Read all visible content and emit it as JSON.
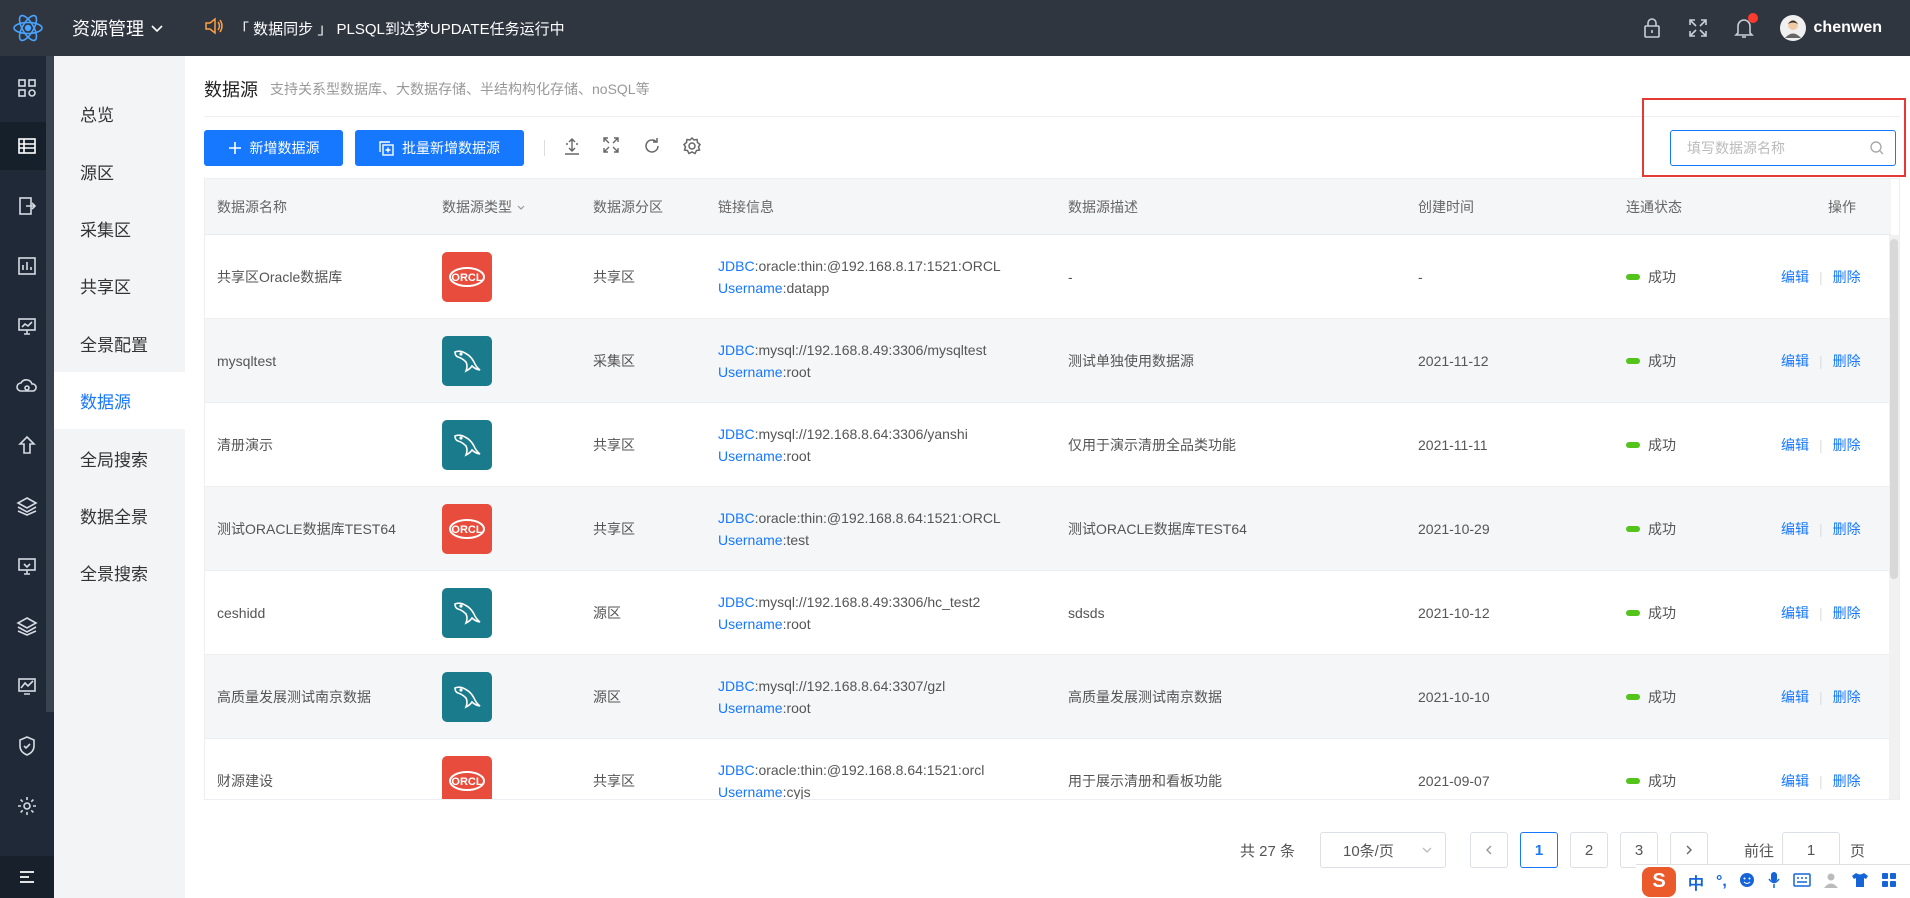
{
  "header": {
    "app_title": "资源管理",
    "announcement": "「 数据同步 」 PLSQL到达梦UPDATE任务运行中",
    "username": "chenwen"
  },
  "sidebar": {
    "items": [
      {
        "label": "总览"
      },
      {
        "label": "源区"
      },
      {
        "label": "采集区"
      },
      {
        "label": "共享区"
      },
      {
        "label": "全景配置"
      },
      {
        "label": "数据源",
        "active": true
      },
      {
        "label": "全局搜索"
      },
      {
        "label": "数据全景"
      },
      {
        "label": "全景搜索"
      }
    ]
  },
  "page": {
    "title": "数据源",
    "subtitle": "支持关系型数据库、大数据存储、半结构构化存储、noSQL等"
  },
  "toolbar": {
    "add_label": "新增数据源",
    "batch_add_label": "批量新增数据源"
  },
  "search": {
    "placeholder": "填写数据源名称",
    "value": ""
  },
  "table": {
    "columns": {
      "name": "数据源名称",
      "type": "数据源类型",
      "zone": "数据源分区",
      "link": "链接信息",
      "desc": "数据源描述",
      "created": "创建时间",
      "status": "连通状态",
      "ops": "操作"
    },
    "jdbc_label": "JDBC",
    "username_label": "Username",
    "edit_label": "编辑",
    "delete_label": "删除",
    "op_sep": "|",
    "rows": [
      {
        "name": "共享区Oracle数据库",
        "type": "oracle",
        "icon_text": "ORCL",
        "zone": "共享区",
        "jdbc": ":oracle:thin:@192.168.8.17:1521:ORCL",
        "username": ":datapp",
        "desc": "-",
        "created": "-",
        "status": "成功"
      },
      {
        "name": "mysqltest",
        "type": "mysql",
        "icon_text": "",
        "zone": "采集区",
        "jdbc": ":mysql://192.168.8.49:3306/mysqltest",
        "username": ":root",
        "desc": "测试单独使用数据源",
        "created": "2021-11-12",
        "status": "成功"
      },
      {
        "name": "清册演示",
        "type": "mysql",
        "icon_text": "",
        "zone": "共享区",
        "jdbc": ":mysql://192.168.8.64:3306/yanshi",
        "username": ":root",
        "desc": "仅用于演示清册全品类功能",
        "created": "2021-11-11",
        "status": "成功"
      },
      {
        "name": "测试ORACLE数据库TEST64",
        "type": "oracle",
        "icon_text": "ORCL",
        "zone": "共享区",
        "jdbc": ":oracle:thin:@192.168.8.64:1521:ORCL",
        "username": ":test",
        "desc": "测试ORACLE数据库TEST64",
        "created": "2021-10-29",
        "status": "成功"
      },
      {
        "name": "ceshidd",
        "type": "mysql",
        "icon_text": "",
        "zone": "源区",
        "jdbc": ":mysql://192.168.8.49:3306/hc_test2",
        "username": ":root",
        "desc": "sdsds",
        "created": "2021-10-12",
        "status": "成功"
      },
      {
        "name": "高质量发展测试南京数据",
        "type": "mysql",
        "icon_text": "",
        "zone": "源区",
        "jdbc": ":mysql://192.168.8.64:3307/gzl",
        "username": ":root",
        "desc": "高质量发展测试南京数据",
        "created": "2021-10-10",
        "status": "成功"
      },
      {
        "name": "财源建设",
        "type": "oracle",
        "icon_text": "ORCL",
        "zone": "共享区",
        "jdbc": ":oracle:thin:@192.168.8.64:1521:orcl",
        "username": ":cyjs",
        "desc": "用于展示清册和看板功能",
        "created": "2021-09-07",
        "status": "成功"
      }
    ]
  },
  "pagination": {
    "total_text": "共 27 条",
    "page_size": "10条/页",
    "pages": [
      "1",
      "2",
      "3"
    ],
    "current": "1",
    "goto_label": "前往",
    "goto_value": "1",
    "page_suffix": "页"
  },
  "ime": {
    "logo": "S",
    "mode": "中",
    "punct": "°,"
  },
  "colors": {
    "accent": "#1677ff",
    "topbar": "#2f3640",
    "success": "#52c41a",
    "oracle": "#e74c3c",
    "mysql": "#1a7b8c"
  }
}
